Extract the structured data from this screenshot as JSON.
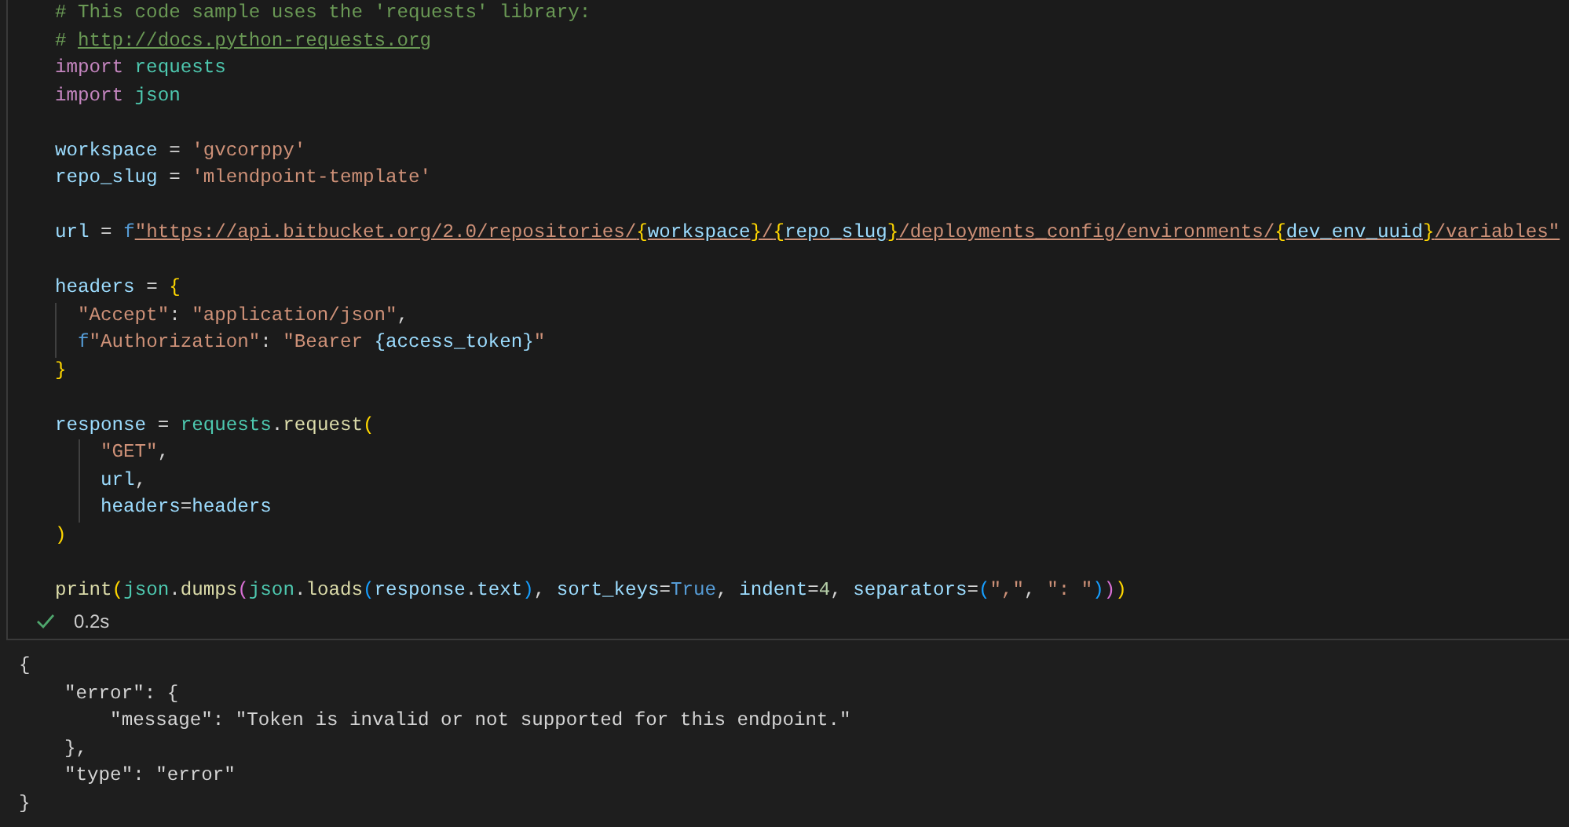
{
  "code_cell": {
    "lines": [
      {
        "kind": "code",
        "tokens": [
          {
            "kind": "comment",
            "text": "# This code sample uses the 'requests' library:"
          }
        ]
      },
      {
        "kind": "code",
        "tokens": [
          {
            "kind": "comment",
            "text": "# "
          },
          {
            "kind": "comment-link",
            "text": "http://docs.python-requests.org"
          }
        ]
      },
      {
        "kind": "code",
        "tokens": [
          {
            "kind": "keyword",
            "text": "import"
          },
          {
            "kind": "module",
            "text": " requests"
          }
        ]
      },
      {
        "kind": "code",
        "tokens": [
          {
            "kind": "keyword",
            "text": "import"
          },
          {
            "kind": "module",
            "text": " json"
          }
        ]
      },
      {
        "kind": "blank"
      },
      {
        "kind": "code",
        "tokens": [
          {
            "kind": "variable",
            "text": "workspace"
          },
          {
            "kind": "plain",
            "text": " = "
          },
          {
            "kind": "string",
            "text": "'gvcorppy'"
          }
        ]
      },
      {
        "kind": "code",
        "tokens": [
          {
            "kind": "variable",
            "text": "repo_slug"
          },
          {
            "kind": "plain",
            "text": " = "
          },
          {
            "kind": "string",
            "text": "'mlendpoint-template'"
          }
        ]
      },
      {
        "kind": "blank"
      },
      {
        "kind": "code",
        "tokens": [
          {
            "kind": "variable",
            "text": "url"
          },
          {
            "kind": "plain",
            "text": " = "
          },
          {
            "kind": "prefix",
            "text": "f"
          },
          {
            "kind": "fstring",
            "text": "\"https://api.bitbucket.org/2.0/repositories/"
          },
          {
            "kind": "fbrace",
            "text": "{"
          },
          {
            "kind": "fvar",
            "text": "workspace"
          },
          {
            "kind": "fbrace",
            "text": "}"
          },
          {
            "kind": "fstring",
            "text": "/"
          },
          {
            "kind": "fbrace",
            "text": "{"
          },
          {
            "kind": "fvar",
            "text": "repo_slug"
          },
          {
            "kind": "fbrace",
            "text": "}"
          },
          {
            "kind": "fstring",
            "text": "/deployments_config/environments/"
          },
          {
            "kind": "fbrace",
            "text": "{"
          },
          {
            "kind": "fvar",
            "text": "dev_env_uuid"
          },
          {
            "kind": "fbrace",
            "text": "}"
          },
          {
            "kind": "fstring",
            "text": "/variables\""
          }
        ]
      },
      {
        "kind": "blank"
      },
      {
        "kind": "code",
        "tokens": [
          {
            "kind": "variable",
            "text": "headers"
          },
          {
            "kind": "plain",
            "text": " = "
          },
          {
            "kind": "bracket",
            "text": "{"
          }
        ]
      },
      {
        "kind": "code",
        "guide": true,
        "tokens": [
          {
            "kind": "string",
            "text": "  \"Accept\""
          },
          {
            "kind": "plain",
            "text": ": "
          },
          {
            "kind": "string",
            "text": "\"application/json\""
          },
          {
            "kind": "plain",
            "text": ","
          }
        ]
      },
      {
        "kind": "code",
        "guide": true,
        "tokens": [
          {
            "kind": "prefix",
            "text": "  f"
          },
          {
            "kind": "string",
            "text": "\"Authorization\""
          },
          {
            "kind": "plain",
            "text": ": "
          },
          {
            "kind": "string",
            "text": "\"Bearer "
          },
          {
            "kind": "variable",
            "text": "{access_token}"
          },
          {
            "kind": "string",
            "text": "\""
          }
        ]
      },
      {
        "kind": "code",
        "tokens": [
          {
            "kind": "bracket",
            "text": "}"
          }
        ]
      },
      {
        "kind": "blank"
      },
      {
        "kind": "code",
        "tokens": [
          {
            "kind": "variable",
            "text": "response"
          },
          {
            "kind": "plain",
            "text": " = "
          },
          {
            "kind": "module",
            "text": "requests"
          },
          {
            "kind": "plain",
            "text": "."
          },
          {
            "kind": "function",
            "text": "request"
          },
          {
            "kind": "bracket",
            "text": "("
          }
        ]
      },
      {
        "kind": "code",
        "guide": true,
        "tokens": [
          {
            "kind": "string",
            "text": "    \"GET\""
          },
          {
            "kind": "plain",
            "text": ","
          }
        ]
      },
      {
        "kind": "code",
        "guide": true,
        "tokens": [
          {
            "kind": "variable",
            "text": "    url"
          },
          {
            "kind": "plain",
            "text": ","
          }
        ]
      },
      {
        "kind": "code",
        "guide": true,
        "tokens": [
          {
            "kind": "variable",
            "text": "    headers"
          },
          {
            "kind": "plain",
            "text": "="
          },
          {
            "kind": "variable",
            "text": "headers"
          }
        ]
      },
      {
        "kind": "code",
        "tokens": [
          {
            "kind": "bracket",
            "text": ")"
          }
        ]
      },
      {
        "kind": "blank"
      },
      {
        "kind": "code",
        "tokens": [
          {
            "kind": "function",
            "text": "print"
          },
          {
            "kind": "bracket",
            "text": "("
          },
          {
            "kind": "module",
            "text": "json"
          },
          {
            "kind": "plain",
            "text": "."
          },
          {
            "kind": "function",
            "text": "dumps"
          },
          {
            "kind": "bracket2",
            "text": "("
          },
          {
            "kind": "module",
            "text": "json"
          },
          {
            "kind": "plain",
            "text": "."
          },
          {
            "kind": "function",
            "text": "loads"
          },
          {
            "kind": "bracket3",
            "text": "("
          },
          {
            "kind": "variable",
            "text": "response"
          },
          {
            "kind": "plain",
            "text": "."
          },
          {
            "kind": "variable",
            "text": "text"
          },
          {
            "kind": "bracket3",
            "text": ")"
          },
          {
            "kind": "plain",
            "text": ", "
          },
          {
            "kind": "variable",
            "text": "sort_keys"
          },
          {
            "kind": "plain",
            "text": "="
          },
          {
            "kind": "constant",
            "text": "True"
          },
          {
            "kind": "plain",
            "text": ", "
          },
          {
            "kind": "variable",
            "text": "indent"
          },
          {
            "kind": "plain",
            "text": "="
          },
          {
            "kind": "number",
            "text": "4"
          },
          {
            "kind": "plain",
            "text": ", "
          },
          {
            "kind": "variable",
            "text": "separators"
          },
          {
            "kind": "plain",
            "text": "="
          },
          {
            "kind": "bracket3",
            "text": "("
          },
          {
            "kind": "string",
            "text": "\",\""
          },
          {
            "kind": "plain",
            "text": ", "
          },
          {
            "kind": "string",
            "text": "\": \""
          },
          {
            "kind": "bracket3",
            "text": ")"
          },
          {
            "kind": "bracket2",
            "text": ")"
          },
          {
            "kind": "bracket",
            "text": ")"
          }
        ]
      }
    ]
  },
  "cell_status": {
    "succeeded": true,
    "duration": "0.2s"
  },
  "output": {
    "lines": [
      "{",
      "    \"error\": {",
      "        \"message\": \"Token is invalid or not supported for this endpoint.\"",
      "    },",
      "    \"type\": \"error\"",
      "}"
    ]
  }
}
